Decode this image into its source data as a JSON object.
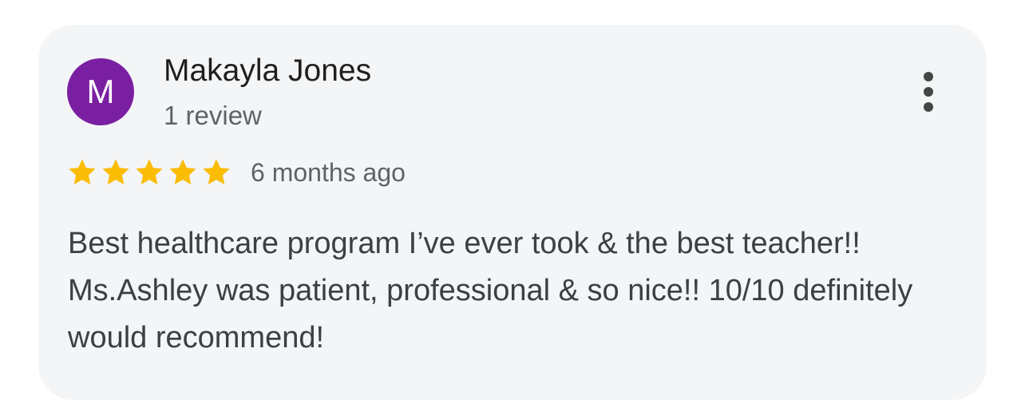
{
  "review": {
    "avatar_initial": "M",
    "avatar_color": "#7b1fa2",
    "reviewer_name": "Makayla Jones",
    "reviewer_meta": "1 review",
    "rating": 5,
    "rating_max": 5,
    "star_color": "#fbbc04",
    "time_ago": "6 months ago",
    "text": "Best healthcare program I’ve ever took & the best teacher!! Ms.Ashley was patient, professional & so nice!! 10/10 definitely would recommend!",
    "menu_icon": "more-vertical-icon",
    "star_icon": "star-icon"
  }
}
